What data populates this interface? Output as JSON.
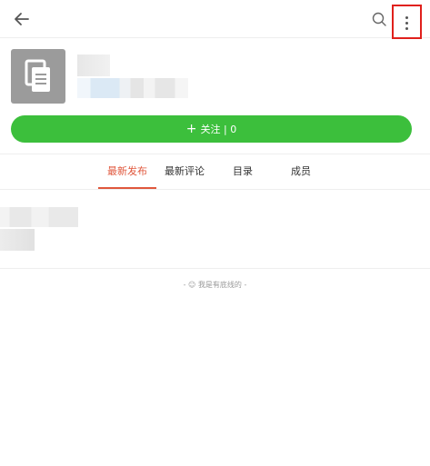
{
  "tabs": [
    {
      "label": "最新发布",
      "active": true
    },
    {
      "label": "最新评论",
      "active": false
    },
    {
      "label": "目录",
      "active": false
    },
    {
      "label": "成员",
      "active": false
    }
  ],
  "follow": {
    "plus": "+",
    "label": "关注 | 0"
  },
  "footer": {
    "note": "- ☺ 我是有底线的 -"
  },
  "icons": {
    "back": "arrow-left-icon",
    "search": "search-icon",
    "more": "more-vertical-icon",
    "avatar": "documents-icon"
  },
  "colors": {
    "accent_green": "#3cbf3c",
    "active_tab": "#e0573c",
    "highlight_box": "#e0201c"
  }
}
